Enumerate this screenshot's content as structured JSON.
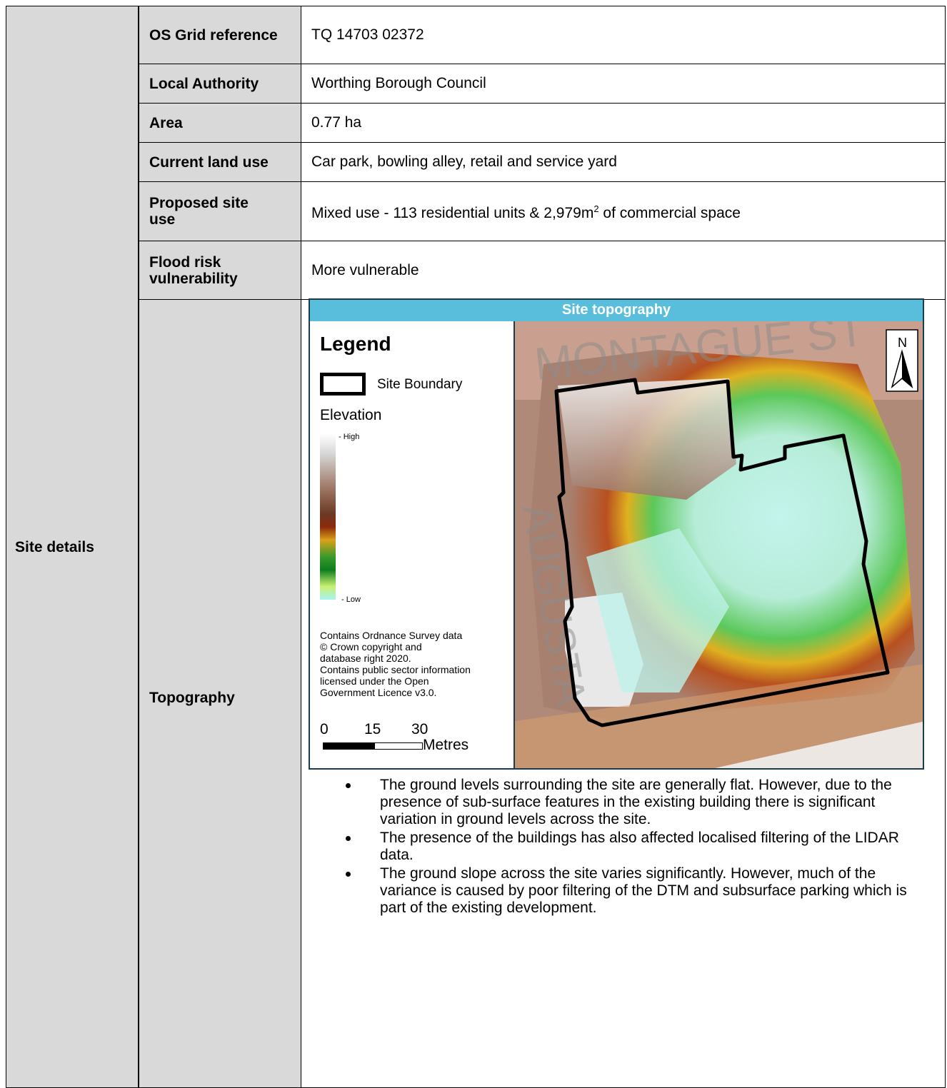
{
  "section_label": "Site details",
  "rows": [
    {
      "label": "OS Grid reference",
      "value": "TQ 14703 02372"
    },
    {
      "label": "Local Authority",
      "value": "Worthing Borough Council"
    },
    {
      "label": "Area",
      "value": "0.77 ha"
    },
    {
      "label": "Current land use",
      "value": "Car park, bowling alley, retail and service yard"
    },
    {
      "label": "Proposed site use",
      "value_prefix": "Mixed use - 113 residential units & 2,979m",
      "value_sup": "2",
      "value_suffix": " of commercial space"
    },
    {
      "label": "Flood risk vulnerability",
      "value": "More vulnerable"
    }
  ],
  "topography": {
    "label": "Topography",
    "map": {
      "title": "Site topography",
      "legend_heading": "Legend",
      "site_boundary_label": "Site Boundary",
      "elevation_label": "Elevation",
      "high_label": "- High",
      "low_label": "- Low",
      "copyright": [
        "Contains Ordnance Survey data",
        "© Crown copyright and",
        "database right 2020.",
        "Contains public sector information",
        "licensed under the Open",
        "Government Licence v3.0."
      ],
      "scale_ticks": [
        "0",
        "15",
        "30"
      ],
      "scale_unit": "Metres",
      "north_label": "N",
      "street_labels": [
        "MONTAGUE ST",
        "AUGUSTA"
      ]
    },
    "bullets": [
      "The ground levels surrounding the site are generally flat.  However, due to the presence of sub-surface features in the existing building there is significant variation in ground levels across the site.",
      "The presence of the buildings has also affected localised filtering of the LIDAR data.",
      "The ground slope across the site varies significantly.  However, much of the variance is caused by poor filtering of the DTM and subsurface parking which is part of the existing development."
    ]
  }
}
